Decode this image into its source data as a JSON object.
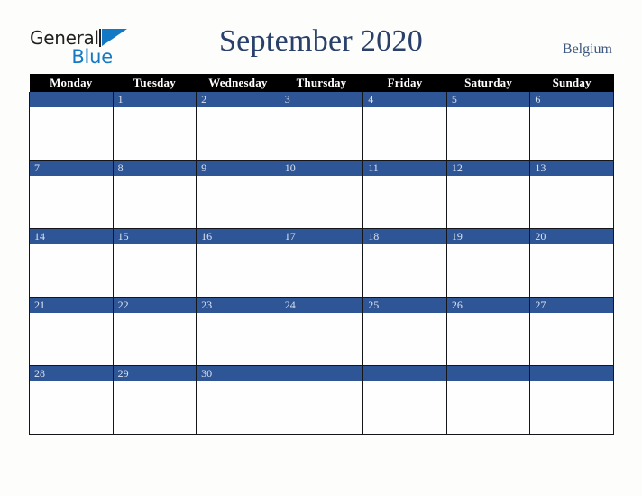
{
  "brand": {
    "name_part1": "General",
    "name_part2": "Blue",
    "logo_mark": "blue-triangle",
    "color_dark": "#231f20",
    "color_blue": "#1379c4"
  },
  "header": {
    "title": "September 2020",
    "region": "Belgium",
    "title_color": "#29406b"
  },
  "calendar": {
    "month": "September",
    "year": "2020",
    "week_start": "Monday",
    "accent_color": "#2e5596",
    "header_bg": "#000000",
    "weekday_headers": [
      "Monday",
      "Tuesday",
      "Wednesday",
      "Thursday",
      "Friday",
      "Saturday",
      "Sunday"
    ],
    "weeks": [
      {
        "days": [
          "",
          "1",
          "2",
          "3",
          "4",
          "5",
          "6"
        ]
      },
      {
        "days": [
          "7",
          "8",
          "9",
          "10",
          "11",
          "12",
          "13"
        ]
      },
      {
        "days": [
          "14",
          "15",
          "16",
          "17",
          "18",
          "19",
          "20"
        ]
      },
      {
        "days": [
          "21",
          "22",
          "23",
          "24",
          "25",
          "26",
          "27"
        ]
      },
      {
        "days": [
          "28",
          "29",
          "30",
          "",
          "",
          "",
          ""
        ]
      }
    ]
  }
}
